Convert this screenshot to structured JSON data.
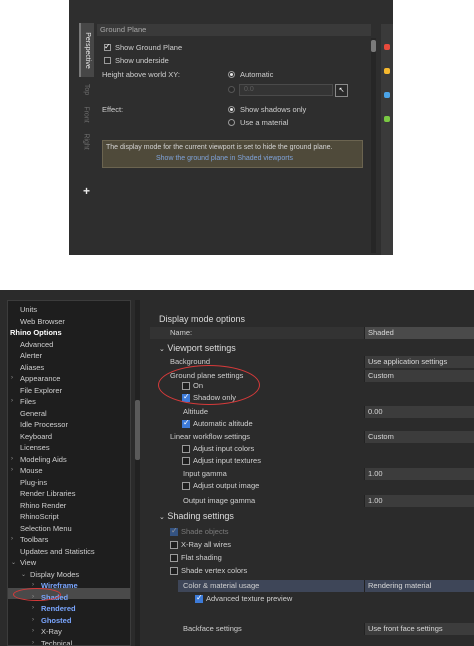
{
  "top_panel": {
    "tabs": [
      "Perspective",
      "Top",
      "Front",
      "Right",
      "+"
    ],
    "title": "Ground Plane",
    "show_ground_plane_label": "Show Ground Plane",
    "show_ground_plane_checked": true,
    "show_underside_label": "Show underside",
    "show_underside_checked": false,
    "height_label": "Height above world XY:",
    "height_mode_automatic": "Automatic",
    "height_value": "0.0",
    "effect_label": "Effect:",
    "effect_shadows_only": "Show shadows only",
    "effect_use_material": "Use a material",
    "info_message": "The display mode for the current viewport is set to hide the ground plane.",
    "info_link": "Show the ground plane in Shaded viewports",
    "side_icon_colors": [
      "#e84a3c",
      "#f5b82e",
      "#4aa3e8",
      "#7ac943"
    ]
  },
  "tree": {
    "items": [
      "Units",
      "Web Browser",
      "Rhino Options",
      "Advanced",
      "Alerter",
      "Aliases",
      "Appearance",
      "File Explorer",
      "Files",
      "General",
      "Idle Processor",
      "Keyboard",
      "Licenses",
      "Modeling Aids",
      "Mouse",
      "Plug-ins",
      "Render Libraries",
      "Rhino Render",
      "RhinoScript",
      "Selection Menu",
      "Toolbars",
      "Updates and Statistics",
      "View",
      "Display Modes",
      "Wireframe",
      "Shaded",
      "Rendered",
      "Ghosted",
      "X-Ray",
      "Technical"
    ],
    "selected": "Shaded"
  },
  "settings": {
    "heading": "Display mode options",
    "name_label": "Name:",
    "name_value": "Shaded",
    "viewport_heading": "Viewport settings",
    "background_label": "Background",
    "background_value": "Use application settings",
    "ground_plane_label": "Ground plane settings",
    "ground_plane_value": "Custom",
    "on_label": "On",
    "on_checked": false,
    "shadow_only_label": "Shadow only",
    "shadow_only_checked": true,
    "altitude_label": "Altitude",
    "altitude_value": "0.00",
    "automatic_altitude_label": "Automatic altitude",
    "automatic_altitude_checked": true,
    "linear_workflow_label": "Linear workflow settings",
    "linear_workflow_value": "Custom",
    "adjust_input_colors_label": "Adjust input colors",
    "adjust_input_textures_label": "Adjust input textures",
    "input_gamma_label": "Input gamma",
    "input_gamma_value": "1.00",
    "adjust_output_image_label": "Adjust output image",
    "output_gamma_label": "Output image gamma",
    "output_gamma_value": "1.00",
    "shading_heading": "Shading settings",
    "shade_objects_label": "Shade objects",
    "xray_all_wires_label": "X-Ray all wires",
    "flat_shading_label": "Flat shading",
    "shade_vertex_colors_label": "Shade vertex colors",
    "color_material_label": "Color & material usage",
    "color_material_value": "Rendering material",
    "advanced_texture_label": "Advanced texture preview",
    "advanced_texture_checked": true,
    "backface_label": "Backface settings",
    "backface_value": "Use front face settings"
  },
  "colors": {
    "highlight_ellipse": "#d63a3a",
    "link_blue": "#7aa6ff",
    "checkbox_blue": "#3d7bd9"
  }
}
